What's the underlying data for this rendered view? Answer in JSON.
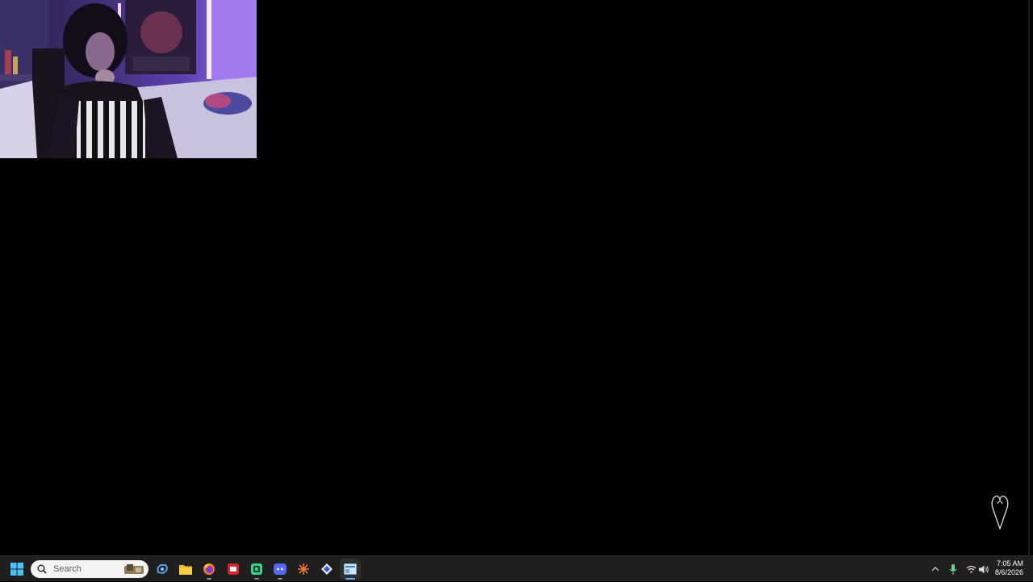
{
  "taskbar": {
    "search_placeholder": "Search",
    "apps": [
      {
        "name": "Windows Start",
        "icon": "windows-logo-icon"
      },
      {
        "name": "Copilot",
        "icon": "copilot-icon"
      },
      {
        "name": "File Explorer",
        "icon": "folder-icon"
      },
      {
        "name": "Firefox",
        "icon": "firefox-icon"
      },
      {
        "name": "Red app",
        "icon": "red-app-icon"
      },
      {
        "name": "Green app",
        "icon": "green-app-icon"
      },
      {
        "name": "Discord",
        "icon": "discord-icon"
      },
      {
        "name": "Orange app",
        "icon": "orange-burst-icon"
      },
      {
        "name": "Diamond app",
        "icon": "diamond-app-icon"
      },
      {
        "name": "Active window",
        "icon": "window-app-icon"
      }
    ],
    "tray_icons": [
      "chevron-up-icon",
      "microphone-icon",
      "wifi-icon",
      "speaker-icon"
    ],
    "clock": {
      "time": "7:05 AM",
      "date": "8/6/2026"
    }
  },
  "colors": {
    "desktop_bg": "#000000",
    "taskbar_bg": "#1f1f1f",
    "accent": "#5fb2ff"
  }
}
